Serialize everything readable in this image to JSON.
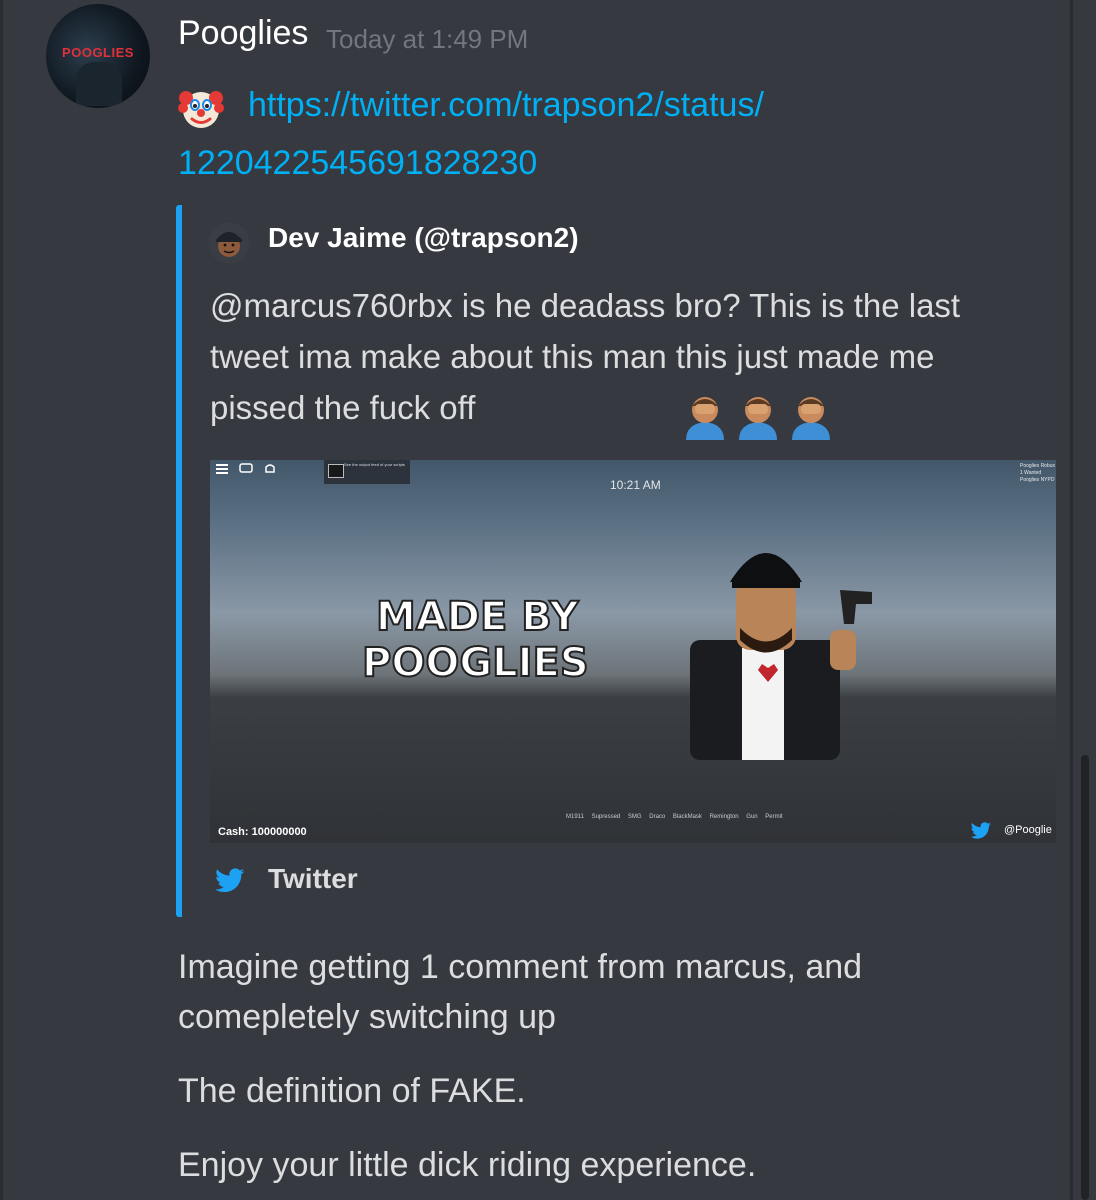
{
  "message": {
    "author": "Pooglies",
    "timestamp": "Today at 1:49 PM",
    "avatar_text": "POOGLIES",
    "link_line1": "https://twitter.com/trapson2/status/",
    "link_line2": "1220422545691828230",
    "text_lines": [
      "Imagine getting 1 comment from marcus, and comepletely switching up",
      "The definition of FAKE.",
      "Enjoy your little dick riding experience."
    ]
  },
  "embed": {
    "accent_color": "#1da1f2",
    "author": "Dev Jaime (@trapson2)",
    "tweet_text": "@marcus760rbx is he deadass bro? This is the last tweet ima make about this man this just made me pissed the fuck off",
    "footer": "Twitter",
    "media": {
      "clock": "10:21 AM",
      "watermark_line1": "MADE BY",
      "watermark_line2": "POOGLIES",
      "cash": "Cash: 100000000",
      "handle": "@Pooglie",
      "hotbar": "M1911 Supressed SMG Draco BlackMask Remington Gun Permit",
      "popup_text": "See the output feed of your scripts",
      "top_right_text": "Pooglies Robux 1 Wanted Pooglies NYPD"
    }
  },
  "icons": [
    "clown-face-icon",
    "facepalm-icon",
    "twitter-bird-icon"
  ],
  "colors": {
    "background": "#36393f",
    "link": "#00b0f4",
    "username": "#ffffff",
    "timestamp": "#72767d",
    "text": "#dcddde"
  }
}
